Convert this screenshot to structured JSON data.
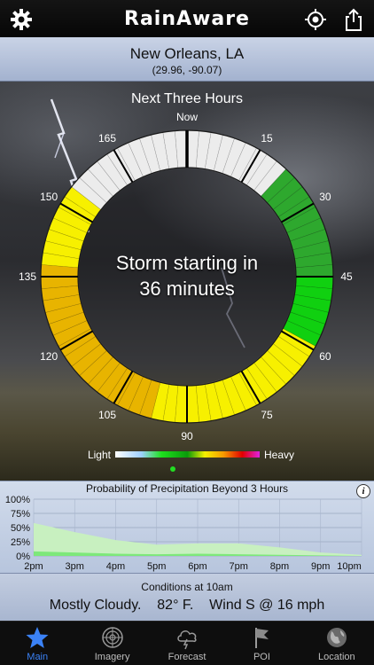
{
  "navbar": {
    "title": "RainAware"
  },
  "location": {
    "city": "New Orleans, LA",
    "coords": "(29.96, -90.07)"
  },
  "forecast_ring": {
    "title": "Next Three Hours",
    "center_text_line1": "Storm starting in",
    "center_text_line2": "36 minutes",
    "tick_labels": [
      "Now",
      "15",
      "30",
      "45",
      "60",
      "75",
      "90",
      "105",
      "120",
      "135",
      "150",
      "165"
    ],
    "segment_intensity_levels": [
      "none",
      "none",
      "none",
      "none",
      "none",
      "none",
      "none",
      "none",
      "none",
      "moderate",
      "moderate",
      "moderate",
      "moderate",
      "moderate",
      "moderate",
      "moderate",
      "moderate",
      "moderate",
      "moderate",
      "heavy-green",
      "heavy-green",
      "heavy-green",
      "heavy-green",
      "heavy-green",
      "heavy-green",
      "light-yellow",
      "light-yellow",
      "light-yellow",
      "light-yellow",
      "light-yellow",
      "light-yellow",
      "light-yellow",
      "light-yellow",
      "light-yellow",
      "light-yellow",
      "light-yellow",
      "light-yellow",
      "light-yellow",
      "light-yellow",
      "light-yellow",
      "light-yellow",
      "gold",
      "gold",
      "gold",
      "gold",
      "gold",
      "gold",
      "gold",
      "gold",
      "gold",
      "gold",
      "gold",
      "gold",
      "gold",
      "gold",
      "gold",
      "gold",
      "gold",
      "light-yellow",
      "light-yellow",
      "light-yellow",
      "light-yellow",
      "light-yellow",
      "light-yellow",
      "light-yellow",
      "none",
      "none",
      "none",
      "none",
      "none",
      "none",
      "none",
      "none",
      "none",
      "none",
      "none"
    ],
    "legend": {
      "light_label": "Light",
      "heavy_label": "Heavy"
    }
  },
  "probability": {
    "title": "Probability of Precipitation Beyond 3 Hours",
    "info_icon": "info-icon"
  },
  "chart_data": {
    "type": "area",
    "title": "Probability of Precipitation Beyond 3 Hours",
    "categories": [
      "2pm",
      "3pm",
      "4pm",
      "5pm",
      "6pm",
      "7pm",
      "8pm",
      "9pm",
      "10pm"
    ],
    "y_ticks": [
      "100%",
      "75%",
      "50%",
      "25%",
      "0%"
    ],
    "ylim": [
      0,
      100
    ],
    "grid": true,
    "series": [
      {
        "color": "#c8f0c0",
        "values": [
          58,
          42,
          28,
          20,
          22,
          22,
          15,
          6,
          2
        ]
      },
      {
        "color": "#7de87a",
        "values": [
          8,
          6,
          4,
          3,
          4,
          3,
          2,
          1,
          0
        ]
      }
    ]
  },
  "conditions": {
    "title": "Conditions at 10am",
    "summary": "Mostly Cloudy.",
    "temperature": "82° F.",
    "wind": "Wind S @ 16 mph"
  },
  "tabs": [
    {
      "label": "Main",
      "icon": "star-icon",
      "active": true
    },
    {
      "label": "Imagery",
      "icon": "radar-icon",
      "active": false
    },
    {
      "label": "Forecast",
      "icon": "cloud-lightning-icon",
      "active": false
    },
    {
      "label": "POI",
      "icon": "flag-icon",
      "active": false
    },
    {
      "label": "Location",
      "icon": "globe-icon",
      "active": false
    }
  ],
  "colors": {
    "accent": "#3b82f6",
    "none": "#ececec",
    "light_yellow": "#f7f000",
    "gold": "#e8b400",
    "heavy_green": "#10d010",
    "moderate_green": "#2ea82e"
  }
}
